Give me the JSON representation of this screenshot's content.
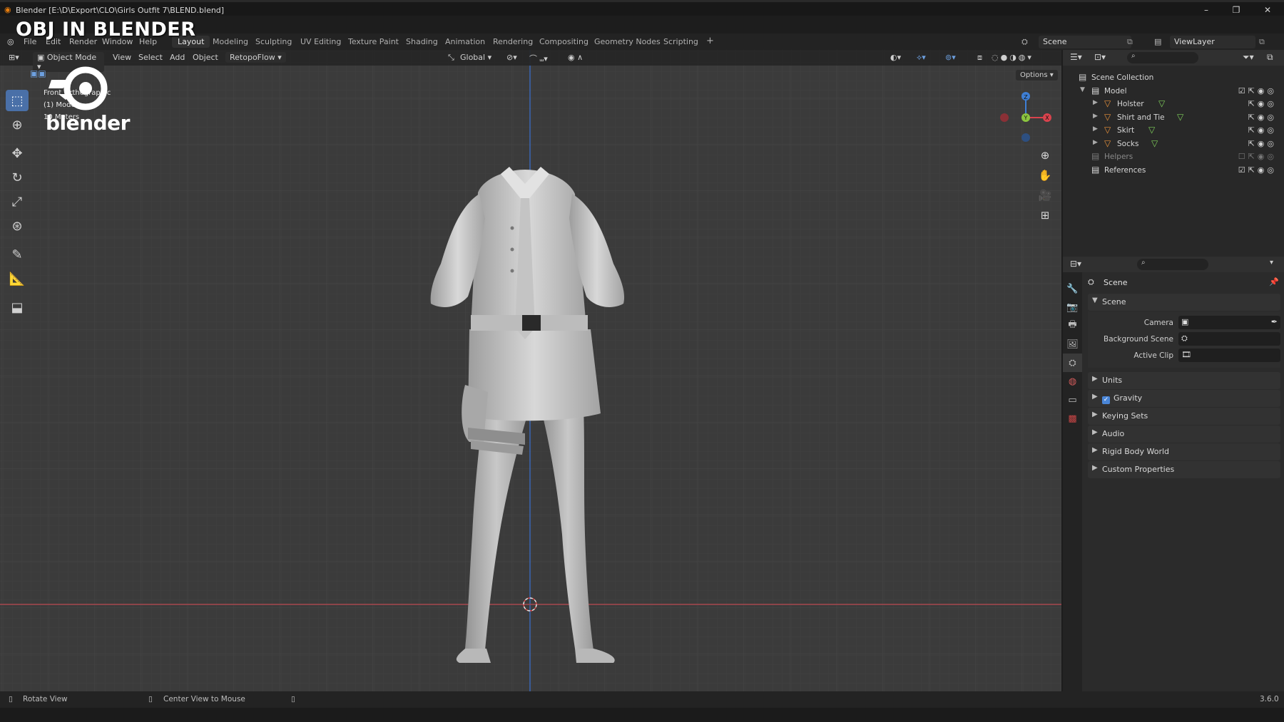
{
  "window": {
    "title": "Blender [E:\\D\\Export\\CLO\\Girls Outfit 7\\BLEND.blend]",
    "controls": [
      "–",
      "❐",
      "✕"
    ]
  },
  "overlay": {
    "heading": "OBJ IN BLENDER",
    "logo_text": "blender"
  },
  "menu": {
    "items": [
      "File",
      "Edit",
      "Render",
      "Window",
      "Help"
    ],
    "workspaces": [
      "Layout",
      "Modeling",
      "Sculpting",
      "UV Editing",
      "Texture Paint",
      "Shading",
      "Animation",
      "Rendering",
      "Compositing",
      "Geometry Nodes",
      "Scripting"
    ],
    "active_workspace": "Layout",
    "add_workspace": "+",
    "scene": "Scene",
    "view_layer": "ViewLayer"
  },
  "viewport": {
    "mode": "Object Mode",
    "menus": [
      "View",
      "Select",
      "Add",
      "Object"
    ],
    "addon": "RetopoFlow",
    "transform_orientation": "Global",
    "options": "Options",
    "info": {
      "view": "Front Orthographic",
      "collection": "(1) Model",
      "scale": "10 Meters"
    },
    "gizmo": {
      "z": "Z",
      "y": "Y",
      "x": "X"
    },
    "tools": [
      "select-box-icon",
      "cursor-icon",
      "move-icon",
      "rotate-icon",
      "scale-icon",
      "transform-icon",
      "annotate-icon",
      "measure-icon",
      "add-cube-icon"
    ],
    "nav": [
      "zoom-icon",
      "pan-icon",
      "camera-icon",
      "grid-icon"
    ]
  },
  "outliner": {
    "root": "Scene Collection",
    "items": [
      {
        "name": "Model",
        "level": 1,
        "type": "collection"
      },
      {
        "name": "Holster",
        "level": 2,
        "type": "mesh"
      },
      {
        "name": "Shirt and Tie",
        "level": 2,
        "type": "mesh"
      },
      {
        "name": "Skirt",
        "level": 2,
        "type": "mesh"
      },
      {
        "name": "Socks",
        "level": 2,
        "type": "mesh"
      },
      {
        "name": "Helpers",
        "level": 1,
        "type": "collection",
        "dim": true
      },
      {
        "name": "References",
        "level": 1,
        "type": "collection"
      }
    ]
  },
  "properties": {
    "context": "Scene",
    "scene_panel": {
      "title": "Scene",
      "fields": [
        {
          "label": "Camera",
          "value": ""
        },
        {
          "label": "Background Scene",
          "value": ""
        },
        {
          "label": "Active Clip",
          "value": ""
        }
      ]
    },
    "panels": [
      "Units",
      "Gravity",
      "Keying Sets",
      "Audio",
      "Rigid Body World",
      "Custom Properties"
    ]
  },
  "status": {
    "left": "Rotate View",
    "middle": "Center View to Mouse",
    "version": "3.6.0"
  },
  "colors": {
    "accent": "#4a70a8",
    "x_axis": "#d9434d",
    "y_axis": "#8bc53f",
    "z_axis": "#3e7fd6",
    "mesh_icon": "#e8913a"
  }
}
